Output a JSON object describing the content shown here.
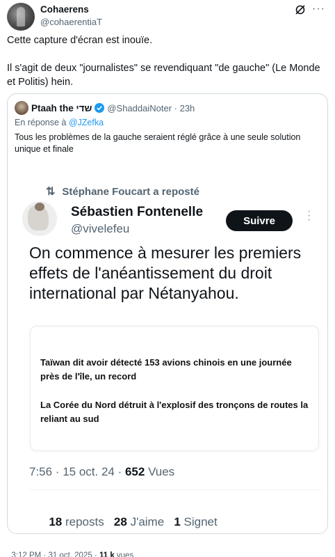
{
  "tweet": {
    "author_name": "Cohaerens",
    "author_handle": "@cohaerentiaT",
    "paragraphs": [
      "Cette capture d'écran est inouïe.",
      "Il s'agit de deux \"journalistes\" se revendiquant \"de gauche\" (Le Monde et Politis) hein."
    ],
    "footer": {
      "time": "3:12 PM · 31 oct. 2025 · ",
      "views_count": "11 k",
      "views_label": " vues"
    }
  },
  "quote": {
    "author_name": "Ptaah the שדי",
    "author_handle": "@ShaddaiNoter",
    "separator": " · ",
    "time": "23h",
    "reply_prefix": "En réponse à ",
    "reply_handle": "@JZefka",
    "text": "Tous les problèmes de la gauche seraient réglé grâce à une seule solution unique et finale"
  },
  "screenshot": {
    "repost_line": "Stéphane Foucart a reposté",
    "author_name": "Sébastien Fontenelle",
    "author_handle": "@vivelefeu",
    "follow_label": "Suivre",
    "text": "On commence à mesurer les premiers effets de l'anéantissement du droit international par Nétanyahou.",
    "news": [
      "Taïwan dit avoir détecté 153 avions chinois en une journée près de l'île, un record",
      "La Corée du Nord détruit à l'explosif des tronçons de routes la reliant au sud"
    ],
    "time": "7:56 · 15 oct. 24 · ",
    "views_count": "652",
    "views_label": " Vues",
    "reposts_count": "18",
    "reposts_label": " reposts",
    "likes_count": "28",
    "likes_label": " J'aime",
    "bookmarks_count": "1",
    "bookmarks_label": " Signet"
  },
  "icons": {
    "grok": "grok-icon",
    "more": "more-icon",
    "verified": "verified-badge-icon",
    "repost": "repost-icon"
  },
  "colors": {
    "accent": "#1d9bf0",
    "text": "#0f1419",
    "secondary": "#536471",
    "border": "#cfd9de"
  }
}
